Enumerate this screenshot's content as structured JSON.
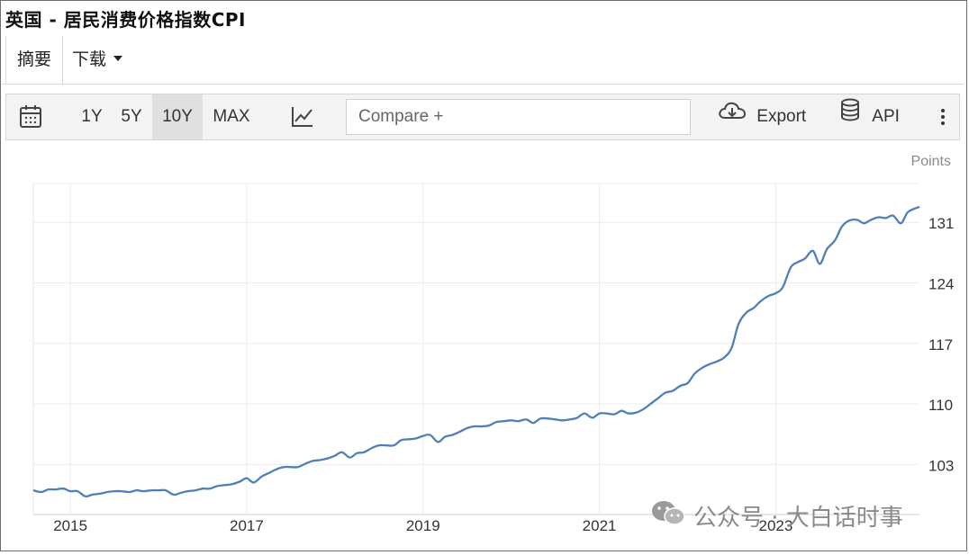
{
  "title": "英国 - 居民消费价格指数CPI",
  "tabs": {
    "summary": "摘要",
    "download": "下载"
  },
  "toolbar": {
    "ranges": [
      "1Y",
      "5Y",
      "10Y",
      "MAX"
    ],
    "active_range": "10Y",
    "compare_placeholder": "Compare +",
    "export_label": "Export",
    "api_label": "API"
  },
  "watermark": "公众号 · 大白话时事",
  "colors": {
    "line": "#4f7fb9",
    "grid": "#ececec"
  },
  "chart_data": {
    "type": "line",
    "ylabel": "Points",
    "x_tick_labels": [
      "2015",
      "2017",
      "2019",
      "2021",
      "2023"
    ],
    "y_tick_labels": [
      "103",
      "110",
      "117",
      "124",
      "131"
    ],
    "xlim": [
      2014.58,
      2024.63
    ],
    "ylim": [
      97.2,
      135.5
    ],
    "grid": true,
    "series": [
      {
        "x": [
          2014.58,
          2014.67,
          2014.75,
          2014.83,
          2014.92,
          2015.0,
          2015.08,
          2015.17,
          2015.25,
          2015.33,
          2015.42,
          2015.5,
          2015.58,
          2015.67,
          2015.75,
          2015.83,
          2015.92,
          2016.0,
          2016.08,
          2016.17,
          2016.25,
          2016.33,
          2016.42,
          2016.5,
          2016.58,
          2016.67,
          2016.75,
          2016.83,
          2016.92,
          2017.0,
          2017.08,
          2017.17,
          2017.25,
          2017.33,
          2017.42,
          2017.5,
          2017.58,
          2017.67,
          2017.75,
          2017.83,
          2017.92,
          2018.0,
          2018.08,
          2018.17,
          2018.25,
          2018.33,
          2018.42,
          2018.5,
          2018.58,
          2018.67,
          2018.75,
          2018.83,
          2018.92,
          2019.0,
          2019.08,
          2019.17,
          2019.25,
          2019.33,
          2019.42,
          2019.5,
          2019.58,
          2019.67,
          2019.75,
          2019.83,
          2019.92,
          2020.0,
          2020.08,
          2020.17,
          2020.25,
          2020.33,
          2020.42,
          2020.5,
          2020.58,
          2020.67,
          2020.75,
          2020.83,
          2020.92,
          2021.0,
          2021.08,
          2021.17,
          2021.25,
          2021.33,
          2021.42,
          2021.5,
          2021.58,
          2021.67,
          2021.75,
          2021.83,
          2021.92,
          2022.0,
          2022.08,
          2022.17,
          2022.25,
          2022.33,
          2022.42,
          2022.5,
          2022.58,
          2022.67,
          2022.75,
          2022.83,
          2022.92,
          2023.0,
          2023.08,
          2023.17,
          2023.25,
          2023.33,
          2023.42,
          2023.5,
          2023.58,
          2023.67,
          2023.75,
          2023.83,
          2023.92,
          2024.0,
          2024.08,
          2024.17,
          2024.25,
          2024.33,
          2024.42,
          2024.5,
          2024.63
        ],
        "y": [
          100.0,
          99.8,
          100.1,
          100.1,
          100.2,
          99.9,
          99.9,
          99.3,
          99.5,
          99.6,
          99.8,
          99.9,
          99.9,
          99.8,
          100.0,
          99.9,
          100.0,
          100.0,
          100.0,
          99.5,
          99.7,
          99.9,
          100.0,
          100.2,
          100.2,
          100.5,
          100.6,
          100.7,
          101.0,
          101.4,
          100.9,
          101.6,
          102.0,
          102.4,
          102.7,
          102.7,
          102.7,
          103.1,
          103.4,
          103.5,
          103.7,
          104.0,
          104.4,
          103.8,
          104.3,
          104.4,
          104.9,
          105.2,
          105.2,
          105.2,
          105.8,
          105.9,
          106.0,
          106.3,
          106.4,
          105.6,
          106.2,
          106.4,
          106.8,
          107.2,
          107.4,
          107.4,
          107.5,
          107.9,
          108.0,
          108.1,
          108.0,
          108.2,
          107.8,
          108.3,
          108.3,
          108.2,
          108.1,
          108.2,
          108.4,
          108.9,
          108.4,
          108.9,
          108.9,
          108.8,
          109.2,
          108.9,
          109.0,
          109.4,
          110.0,
          110.7,
          111.3,
          111.5,
          112.1,
          112.4,
          113.5,
          114.2,
          114.6,
          114.9,
          115.4,
          116.5,
          119.3,
          120.6,
          121.1,
          121.9,
          122.5,
          122.8,
          123.5,
          125.8,
          126.4,
          126.8,
          127.7,
          126.2,
          127.9,
          128.9,
          130.5,
          131.2,
          131.3,
          130.9,
          131.3,
          131.6,
          131.5,
          131.8,
          130.9,
          132.2,
          132.8
        ]
      }
    ]
  }
}
